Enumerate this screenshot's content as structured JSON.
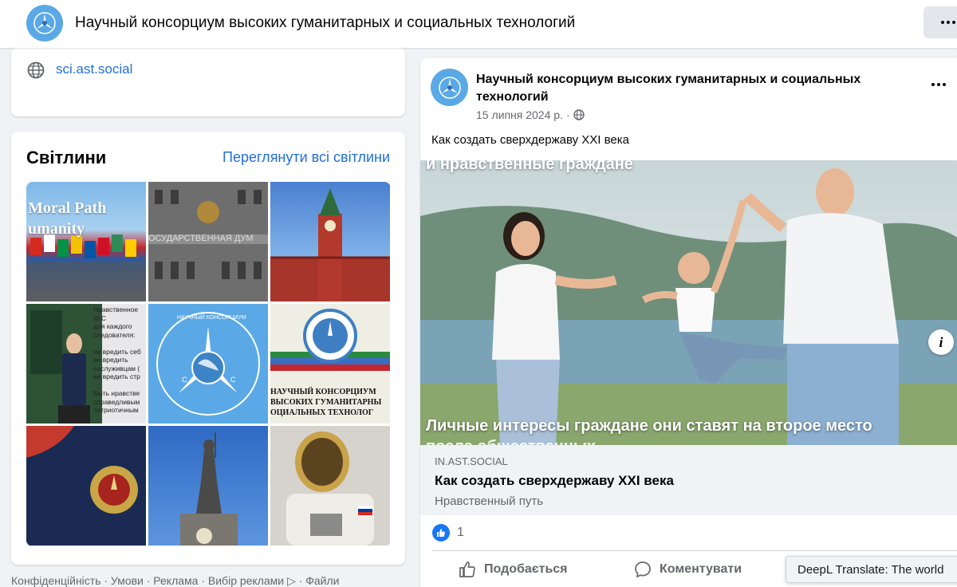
{
  "header": {
    "title": "Научный консорциум высоких гуманитарных и социальных технологий"
  },
  "intro": {
    "website": "sci.ast.social"
  },
  "photos": {
    "heading": "Світлини",
    "see_all": "Переглянути всі світлини",
    "tiles": [
      {
        "caption": "Moral Path\numanity"
      },
      {
        "caption": "ОСУДАРСТВЕННАЯ ДУМ"
      },
      {
        "caption": ""
      },
      {
        "caption": "Нравственное\nIII-С\nдля каждого\nследователя:\n\nне вредить себ\nне вредить\nсослуживцам (\nне вредить стр\n\nБыть нравстве\nсправедливым\nпатриотичным"
      },
      {
        "caption": "НАУЧНЫЙ КОНСОРЦИУМ"
      },
      {
        "caption": "НАУЧНЫЙ КОНСОРЦИУМ\nВЫСОКИХ ГУМАНИТАРНЫ\nОЦИАЛЬНЫХ ТЕХНОЛОГ"
      },
      {
        "caption": ""
      },
      {
        "caption": ""
      },
      {
        "caption": ""
      }
    ]
  },
  "footer": {
    "links": "Конфіденційність · Умови · Реклама · Вибір реклами ▷ · Файли"
  },
  "post": {
    "author": "Научный консорциум высоких гуманитарных и социальных технологий",
    "date": "15 липня 2024 р.",
    "date_sep": "·",
    "text": "Как создать сверхдержаву XXI века",
    "image_text_top": "и нравственные граждане",
    "image_text_bottom": "Личные интересы граждане они ставят на второе место",
    "image_text_bottom2": "после общественных",
    "link_domain": "IN.AST.SOCIAL",
    "link_title": "Как создать сверхдержаву XXI века",
    "link_subtitle": "Нравственный путь",
    "reaction_count": "1",
    "like_label": "Подобається",
    "comment_label": "Коментувати"
  },
  "overlay": {
    "deepl": "DeepL Translate: The world"
  },
  "colors": {
    "link": "#216fdb",
    "logo": "#5aa9e6",
    "like": "#1877f2"
  }
}
